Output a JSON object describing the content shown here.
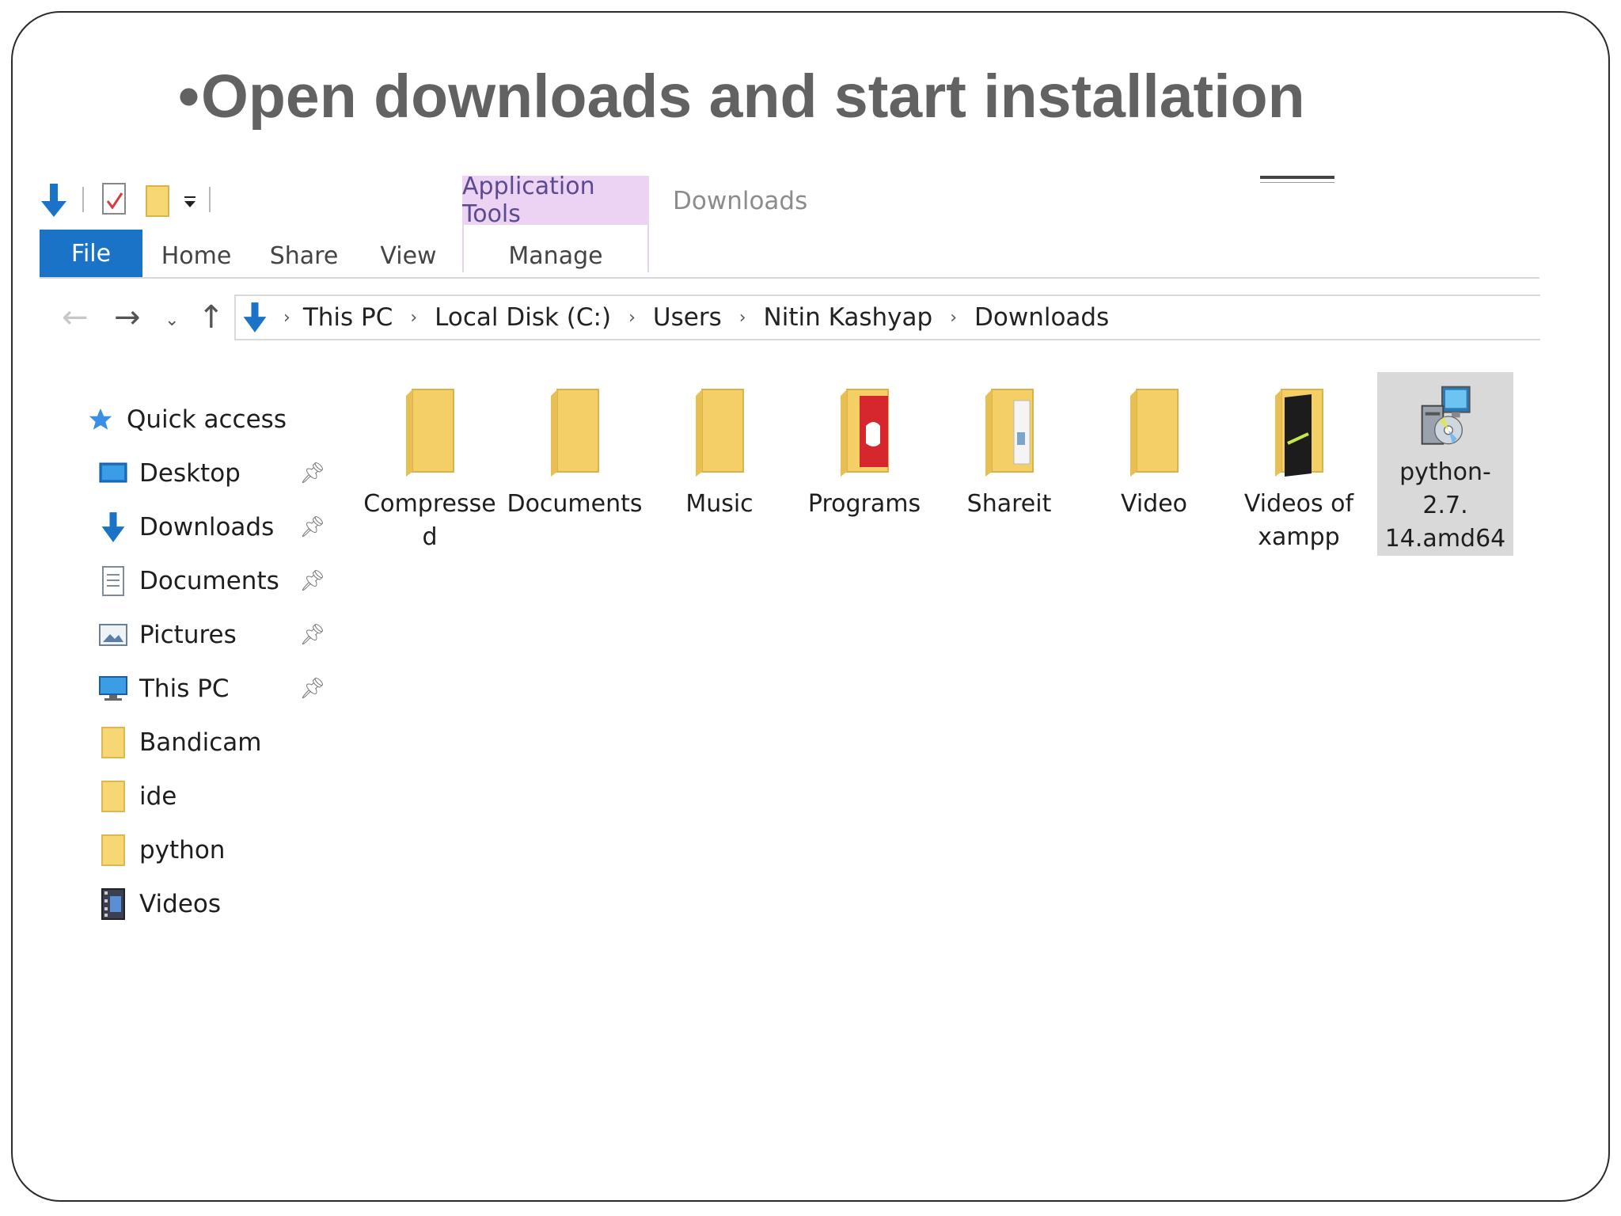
{
  "slide": {
    "bullet": "•",
    "title": "Open downloads and start installation"
  },
  "ribbon": {
    "contextual_tab": "Application Tools",
    "window_title": "Downloads",
    "tabs": {
      "file": "File",
      "home": "Home",
      "share": "Share",
      "view": "View",
      "manage": "Manage"
    }
  },
  "address": {
    "crumbs": [
      "This PC",
      "Local Disk (C:)",
      "Users",
      "Nitin Kashyap",
      "Downloads"
    ],
    "separator": "›"
  },
  "nav_pane": {
    "quick_access": "Quick access",
    "items": [
      {
        "label": "Desktop",
        "icon": "desktop-icon",
        "pinned": true
      },
      {
        "label": "Downloads",
        "icon": "downloads-icon",
        "pinned": true
      },
      {
        "label": "Documents",
        "icon": "documents-icon",
        "pinned": true
      },
      {
        "label": "Pictures",
        "icon": "pictures-icon",
        "pinned": true
      },
      {
        "label": "This PC",
        "icon": "computer-icon",
        "pinned": true
      },
      {
        "label": "Bandicam",
        "icon": "folder-icon",
        "pinned": false
      },
      {
        "label": "ide",
        "icon": "folder-icon",
        "pinned": false
      },
      {
        "label": "python",
        "icon": "folder-icon",
        "pinned": false
      },
      {
        "label": "Videos",
        "icon": "videos-icon",
        "pinned": false
      }
    ]
  },
  "files": [
    {
      "label": "Compresse\nd",
      "icon": "folder-icon"
    },
    {
      "label": "Documents",
      "icon": "folder-icon"
    },
    {
      "label": "Music",
      "icon": "folder-icon"
    },
    {
      "label": "Programs",
      "icon": "folder-red-icon"
    },
    {
      "label": "Shareit",
      "icon": "folder-doc-icon"
    },
    {
      "label": "Video",
      "icon": "folder-icon"
    },
    {
      "label": "Videos of\nxampp",
      "icon": "folder-dark-icon"
    },
    {
      "label": "python-2.7.\n14.amd64",
      "icon": "installer-icon",
      "selected": true
    }
  ],
  "colors": {
    "accent": "#1a73c7",
    "context_tab": "#ecd3f4",
    "folder": "#f7d774",
    "selection": "#d9d9d9"
  }
}
